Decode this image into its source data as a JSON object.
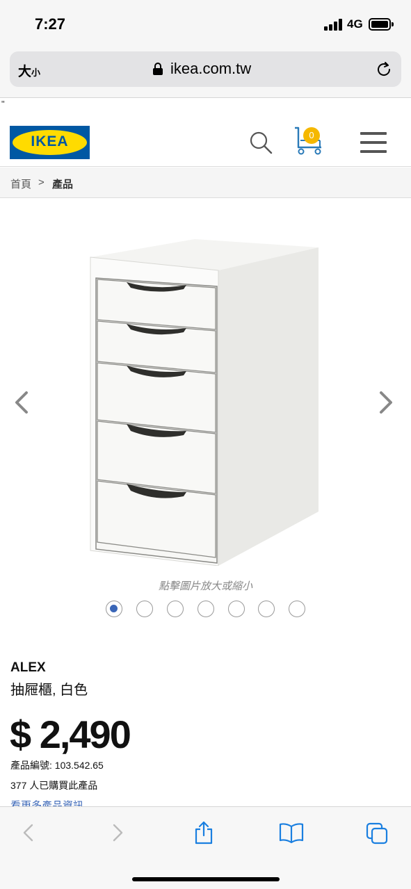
{
  "status_bar": {
    "time": "7:27",
    "network": "4G"
  },
  "browser": {
    "text_size_label": "大",
    "text_size_small": "小",
    "url": "ikea.com.tw",
    "stray_text": "\""
  },
  "header": {
    "logo_text": "IKEA",
    "cart_count": "0",
    "colors": {
      "logo_blue": "#0058a3",
      "logo_yellow": "#ffdb00",
      "badge": "#f5b800"
    }
  },
  "breadcrumb": {
    "home": "首頁",
    "separator": ">",
    "current": "產品"
  },
  "gallery": {
    "zoom_hint": "點擊圖片放大或縮小",
    "image_count": 7,
    "active_index": 0
  },
  "product": {
    "name": "ALEX",
    "description": "抽屜櫃, 白色",
    "price": "$ 2,490",
    "article_number": "產品編號: 103.542.65",
    "purchased": "377 人已購買此產品",
    "more_info": "看更多產品資訊"
  }
}
